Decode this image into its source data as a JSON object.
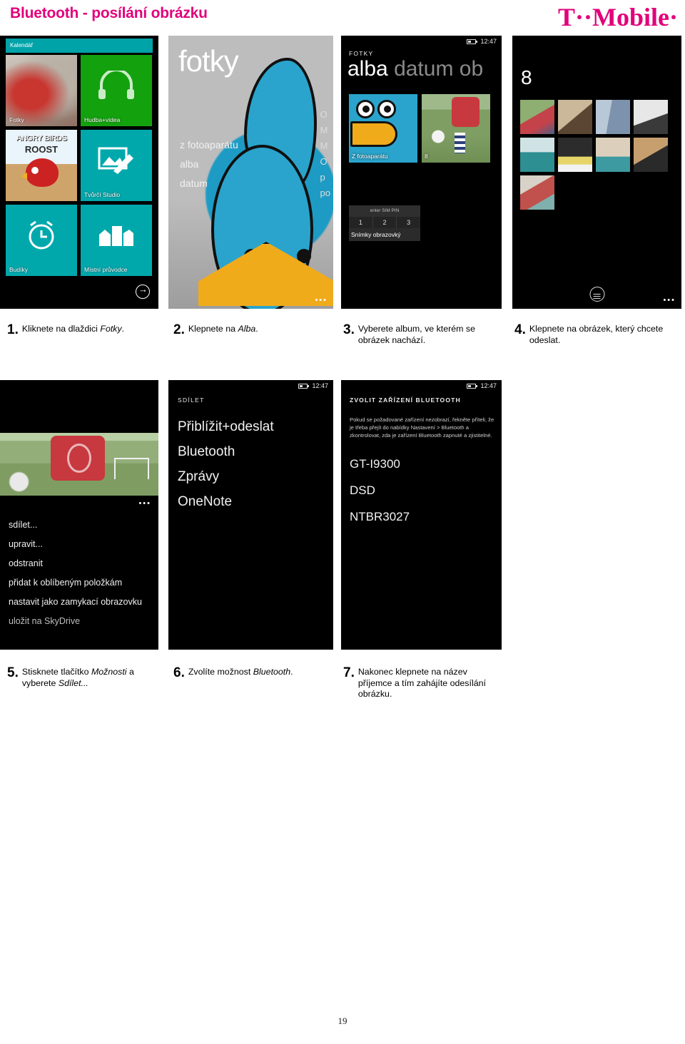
{
  "header": {
    "title": "Bluetooth - posílání obrázku",
    "brand": "T··Mobile·",
    "brand_color": "#e2007a"
  },
  "screens": {
    "start": {
      "tile_kalendar": "Kalendář",
      "tile_fotky": "Fotky",
      "tile_hudba": "Hudba+videa",
      "tile_angry_title": "ANGRY BIRDS",
      "tile_angry_sub": "ROOST",
      "tile_studio": "Tvůrčí Studio",
      "tile_budiky": "Budíky",
      "tile_pruvodce": "Místní průvodce",
      "arrow_icon": "arrow-right-icon"
    },
    "fotky_hub": {
      "title": "fotky",
      "menu": [
        "z fotoaparátu",
        "alba",
        "datum"
      ],
      "menu_right": [
        "O",
        "M",
        "M",
        "O",
        "p",
        "po"
      ],
      "more_icon": "ellipsis-icon"
    },
    "alba": {
      "status_time": "12:47",
      "hub_name": "FOTKY",
      "pivot_active": "alba",
      "pivot_inactive": "datum ob",
      "album1_caption": "Z fotoaparátu",
      "album2_caption": "8",
      "pin_header": "enter SIM PIN",
      "pin_digits": [
        "1",
        "2",
        "3"
      ],
      "pin_caption": "Snímky obrazovký"
    },
    "album8": {
      "title": "8",
      "photo_count": 9,
      "photos": [
        "p-soccer",
        "p-bike",
        "p-blue",
        "p-three",
        "p-pool",
        "p-five",
        "p-pool2",
        "p-skate",
        "p-shoes"
      ],
      "menu_icon": "list-menu-icon",
      "more_icon": "ellipsis-icon"
    },
    "context_menu": {
      "more_icon": "ellipsis-icon",
      "items": [
        "sdílet...",
        "upravit...",
        "odstranit",
        "přidat k oblíbeným položkám",
        "nastavit jako zamykací obrazovku",
        "uložit na SkyDrive"
      ]
    },
    "sdilet": {
      "status_time": "12:47",
      "header": "SDÍLET",
      "items": [
        "Přiblížit+odeslat",
        "Bluetooth",
        "Zprávy",
        "OneNote"
      ]
    },
    "bluetooth": {
      "status_time": "12:47",
      "header": "ZVOLIT ZAŘÍZENÍ BLUETOOTH",
      "hint": "Pokud se požadované zařízení nezobrazí, řekněte příteli, že je třeba přejít do nabídky Nastavení > Bluetooth a zkontrolovat, zda je zařízení Bluetooth zapnuté a zjistitelné.",
      "devices": [
        "GT-I9300",
        "DSD",
        "NTBR3027"
      ]
    }
  },
  "steps": [
    {
      "num": "1.",
      "text_before": "Kliknete na dlaždici ",
      "emphasis": "Fotky",
      "text_after": "."
    },
    {
      "num": "2.",
      "text_before": "Klepnete na ",
      "emphasis": "Alba",
      "text_after": "."
    },
    {
      "num": "3.",
      "text_before": "Vyberete album, ve kterém se obrázek nachází.",
      "emphasis": "",
      "text_after": ""
    },
    {
      "num": "4.",
      "text_before": "Klepnete na obrázek, který chcete odeslat.",
      "emphasis": "",
      "text_after": ""
    },
    {
      "num": "5.",
      "text_before": "Stisknete tlačítko ",
      "emphasis": "Možnosti",
      "text_after": " a vyberete ",
      "emphasis2": "Sdílet...",
      "text_after2": ""
    },
    {
      "num": "6.",
      "text_before": "Zvolíte možnost ",
      "emphasis": "Bluetooth",
      "text_after": "."
    },
    {
      "num": "7.",
      "text_before": "Nakonec klepnete na název příjemce a tím zahájíte odesílání obrázku.",
      "emphasis": "",
      "text_after": ""
    }
  ],
  "footer": {
    "page_number": "19"
  }
}
